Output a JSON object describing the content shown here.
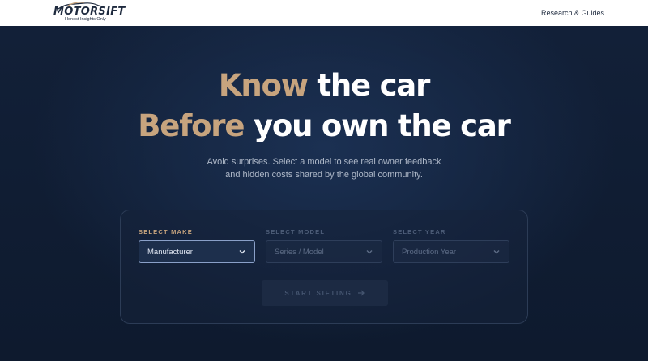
{
  "header": {
    "logo_text": "MOTORSIFT",
    "logo_tagline": "Honest Insights Only",
    "nav_link": "Research & Guides"
  },
  "hero": {
    "line1_accent": "Know",
    "line1_rest": " the car",
    "line2_accent": "Before",
    "line2_rest": " you own the car",
    "subtitle_line1": "Avoid surprises. Select a model to see real owner feedback",
    "subtitle_line2": "and hidden costs shared by the global community."
  },
  "form": {
    "make": {
      "label": "SELECT MAKE",
      "placeholder": "Manufacturer"
    },
    "model": {
      "label": "SELECT MODEL",
      "placeholder": "Series / Model"
    },
    "year": {
      "label": "SELECT YEAR",
      "placeholder": "Production Year"
    },
    "submit_label": "START SIFTING"
  },
  "colors": {
    "accent": "#c7a47e",
    "background": "#0f1a2e",
    "header_bg": "#ffffff"
  },
  "icons": [
    "car-logo-icon",
    "chevron-down-icon",
    "arrow-right-icon"
  ]
}
